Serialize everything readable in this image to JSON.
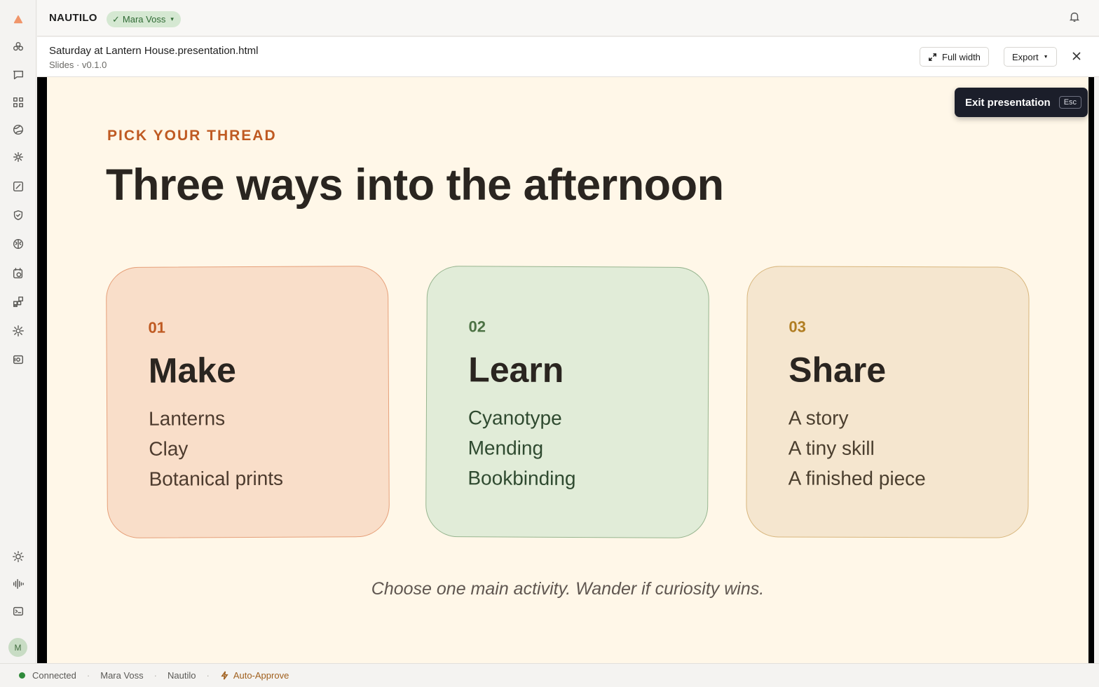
{
  "app": {
    "brand": "NAUTILO",
    "user": "Mara Voss",
    "user_check": "✓",
    "avatar_initial": "M"
  },
  "file": {
    "title": "Saturday at Lantern House.presentation.html",
    "subtitle": "Slides · v0.1.0"
  },
  "toolbar": {
    "full_width_label": "Full width",
    "export_label": "Export"
  },
  "tooltip": {
    "label": "Exit presentation",
    "key": "Esc"
  },
  "slide": {
    "kicker": "PICK YOUR THREAD",
    "headline": "Three ways into the afternoon",
    "cards": [
      {
        "number": "01",
        "name": "Make",
        "items": [
          "Lanterns",
          "Clay",
          "Botanical prints"
        ]
      },
      {
        "number": "02",
        "name": "Learn",
        "items": [
          "Cyanotype",
          "Mending",
          "Bookbinding"
        ]
      },
      {
        "number": "03",
        "name": "Share",
        "items": [
          "A story",
          "A tiny skill",
          "A finished piece"
        ]
      }
    ],
    "footnote": "Choose one main activity. Wander if curiosity wins."
  },
  "status": {
    "connection": "Connected",
    "user": "Mara Voss",
    "workspace": "Nautilo",
    "mode": "Auto-Approve"
  },
  "sidebar_icons": [
    "logo-icon",
    "clusters-icon",
    "chat-icon",
    "grid-icon",
    "globe-icon",
    "spark-icon",
    "edit-box-icon",
    "shield-icon",
    "brain-icon",
    "calendar-clock-icon",
    "widgets-icon",
    "gear-icon",
    "vault-icon",
    "sun-icon",
    "waveform-icon",
    "terminal-icon"
  ],
  "colors": {
    "accent": "#bf5a22",
    "user_pill": "#d5e8d2",
    "slide_bg": "#fff7e8",
    "connected": "#2f8a3a"
  }
}
